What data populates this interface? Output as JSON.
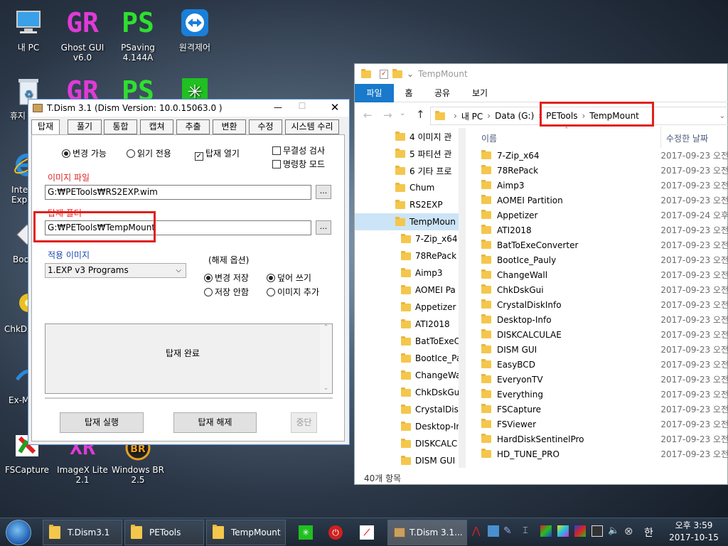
{
  "desktop": {
    "icons": [
      {
        "label1": "내 PC",
        "label2": ""
      },
      {
        "label1": "Ghost GUI",
        "label2": "v6.0"
      },
      {
        "label1": "PSaving",
        "label2": "4.144A"
      },
      {
        "label1": "원격제어",
        "label2": ""
      },
      {
        "label1": "휴지",
        "label2": ""
      },
      {
        "label1": "Inter",
        "label2": "Explo"
      },
      {
        "label1": "Boot",
        "label2": ""
      },
      {
        "label1": "ChkDs",
        "label2": ""
      },
      {
        "label1": "Ex-M",
        "label2": ""
      },
      {
        "label1": "FSCapture",
        "label2": ""
      },
      {
        "label1": "ImageX Lite",
        "label2": "2.1"
      },
      {
        "label1": "Windows BR",
        "label2": "2.5"
      }
    ],
    "logo_gr": "GR",
    "logo_ps": "PS",
    "logo_xr": "XR",
    "logo_br": "BR"
  },
  "tdism": {
    "title": "T.Dism 3.1 (Dism Version: 10.0.15063.0 )",
    "tabs": [
      "탑재",
      "풀기",
      "통합",
      "캡쳐",
      "추출",
      "변환",
      "수정",
      "시스템 수리"
    ],
    "opt_changeable": "변경 가능",
    "opt_readonly": "읽기 전용",
    "opt_mount_open": "탑재 열기",
    "opt_integrity": "무결성 검사",
    "opt_cmd": "명령창 모드",
    "image_file_label": "이미지 파일",
    "image_file_value": "G:₩PETools₩RS2EXP.wim",
    "mount_folder_label": "탑재 폴더",
    "mount_folder_value": "G:₩PETools₩TempMount",
    "browse": "...",
    "apply_image_label": "적용 이미지",
    "apply_image_value": "1.EXP v3 Programs",
    "unmount_options_label": "(해제 옵션)",
    "opt_save_changes": "변경 저장",
    "opt_discard": "저장 안함",
    "opt_overwrite": "덮어 쓰기",
    "opt_add_image": "이미지 추가",
    "status_text": "탑재 완료",
    "btn_mount": "탑재 실행",
    "btn_unmount": "탑재 해제",
    "btn_stop": "중단"
  },
  "explorer": {
    "title": "TempMount",
    "ribbon_tabs": [
      "파일",
      "홈",
      "공유",
      "보기"
    ],
    "breadcrumb": [
      "내 PC",
      "Data (G:)",
      "PETools",
      "TempMount"
    ],
    "col_name": "이름",
    "col_modified": "수정한 날짜",
    "nav_items": [
      "4 이미지 관",
      "5 파티션 관",
      "6 기타 프로",
      "Chum",
      "RS2EXP",
      "TempMoun",
      "7-Zip_x64",
      "78RePack",
      "Aimp3",
      "AOMEI Pa",
      "Appetizer",
      "ATI2018",
      "BatToExeC",
      "BootIce_Pa",
      "ChangeWa",
      "ChkDskGu",
      "CrystalDis",
      "Desktop-In",
      "DISKCALC",
      "DISM GUI"
    ],
    "files": [
      {
        "name": "7-Zip_x64",
        "date": "2017-09-23 오전"
      },
      {
        "name": "78RePack",
        "date": "2017-09-23 오전"
      },
      {
        "name": "Aimp3",
        "date": "2017-09-23 오전"
      },
      {
        "name": "AOMEI Partition",
        "date": "2017-09-23 오전"
      },
      {
        "name": "Appetizer",
        "date": "2017-09-24 오후"
      },
      {
        "name": "ATI2018",
        "date": "2017-09-23 오전"
      },
      {
        "name": "BatToExeConverter",
        "date": "2017-09-23 오전"
      },
      {
        "name": "BootIce_Pauly",
        "date": "2017-09-23 오전"
      },
      {
        "name": "ChangeWall",
        "date": "2017-09-23 오전"
      },
      {
        "name": "ChkDskGui",
        "date": "2017-09-23 오전"
      },
      {
        "name": "CrystalDiskInfo",
        "date": "2017-09-23 오전"
      },
      {
        "name": "Desktop-Info",
        "date": "2017-09-23 오전"
      },
      {
        "name": "DISKCALCULAE",
        "date": "2017-09-23 오전"
      },
      {
        "name": "DISM GUI",
        "date": "2017-09-23 오전"
      },
      {
        "name": "EasyBCD",
        "date": "2017-09-23 오전"
      },
      {
        "name": "EveryonTV",
        "date": "2017-09-23 오전"
      },
      {
        "name": "Everything",
        "date": "2017-09-23 오전"
      },
      {
        "name": "FSCapture",
        "date": "2017-09-23 오전"
      },
      {
        "name": "FSViewer",
        "date": "2017-09-23 오전"
      },
      {
        "name": "HardDiskSentinelPro",
        "date": "2017-09-23 오전"
      },
      {
        "name": "HD_TUNE_PRO",
        "date": "2017-09-23 오전"
      }
    ],
    "status": "40개 항목"
  },
  "taskbar": {
    "items": [
      "T.Dism3.1",
      "PETools",
      "TempMount",
      "T.Dism 3.1..."
    ],
    "time": "오후 3:59",
    "date": "2017-10-15",
    "ime": "한"
  },
  "colors": {
    "accent": "#e0201b",
    "folder": "#f4c74c",
    "ribbon_file": "#1979ca"
  }
}
